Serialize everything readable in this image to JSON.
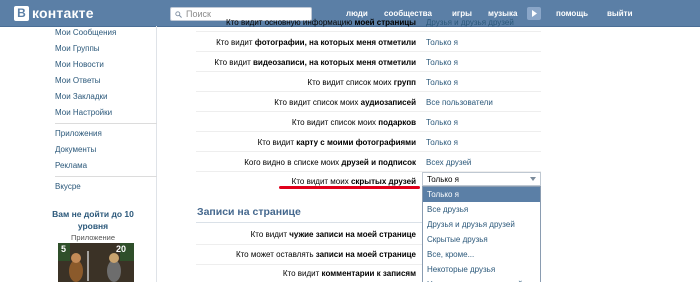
{
  "header": {
    "logo_letter": "В",
    "logo_text": "контакте",
    "search_placeholder": "Поиск",
    "links": [
      "люди",
      "сообщества",
      "игры",
      "музыка",
      "помощь",
      "выйти"
    ]
  },
  "sidebar": {
    "items": [
      "Мои Сообщения",
      "Мои Группы",
      "Мои Новости",
      "Мои Ответы",
      "Мои Закладки",
      "Мои Настройки"
    ],
    "items2": [
      "Приложения",
      "Документы",
      "Реклама"
    ],
    "items3": [
      "Вкусре"
    ],
    "ad_title": "Вам не дойти до 10 уровня",
    "ad_sub": "Приложение",
    "ad_level_left": "5",
    "ad_level_right": "20"
  },
  "settings": {
    "rows": [
      {
        "pre": "Кто видит основную информацию ",
        "bold": "моей страницы",
        "value": "Друзья и друзья друзей"
      },
      {
        "pre": "Кто видит ",
        "bold": "фотографии, на которых меня отметили",
        "value": "Только я"
      },
      {
        "pre": "Кто видит ",
        "bold": "видеозаписи, на которых меня отметили",
        "value": "Только я"
      },
      {
        "pre": "Кто видит список моих ",
        "bold": "групп",
        "value": "Только я"
      },
      {
        "pre": "Кто видит список моих ",
        "bold": "аудиозаписей",
        "value": "Все пользователи"
      },
      {
        "pre": "Кто видит список моих ",
        "bold": "подарков",
        "value": "Только я"
      },
      {
        "pre": "Кто видит ",
        "bold": "карту с моими фотографиями",
        "value": "Только я"
      },
      {
        "pre": "Кого видно в списке моих ",
        "bold": "друзей и подписок",
        "value": "Всех друзей"
      },
      {
        "pre": "Кто видит моих ",
        "bold": "скрытых друзей",
        "value": ""
      }
    ],
    "select_value": "Только я",
    "dropdown_options": [
      "Только я",
      "Все друзья",
      "Друзья и друзья друзей",
      "Скрытые друзья",
      "Все, кроме...",
      "Некоторые друзья",
      "Некоторые списки друзей"
    ],
    "section_title": "Записи на странице",
    "rows2": [
      {
        "pre": "Кто видит ",
        "bold": "чужие записи на моей странице"
      },
      {
        "pre": "Кто может оставлять ",
        "bold": "записи на моей странице"
      },
      {
        "pre": "Кто видит ",
        "bold": "комментарии к записям"
      }
    ]
  },
  "colors": {
    "header_bg": "#5b7fa6",
    "link": "#2b587a",
    "accent_red": "#e0001b",
    "selected_bg": "#5b7fa6"
  }
}
